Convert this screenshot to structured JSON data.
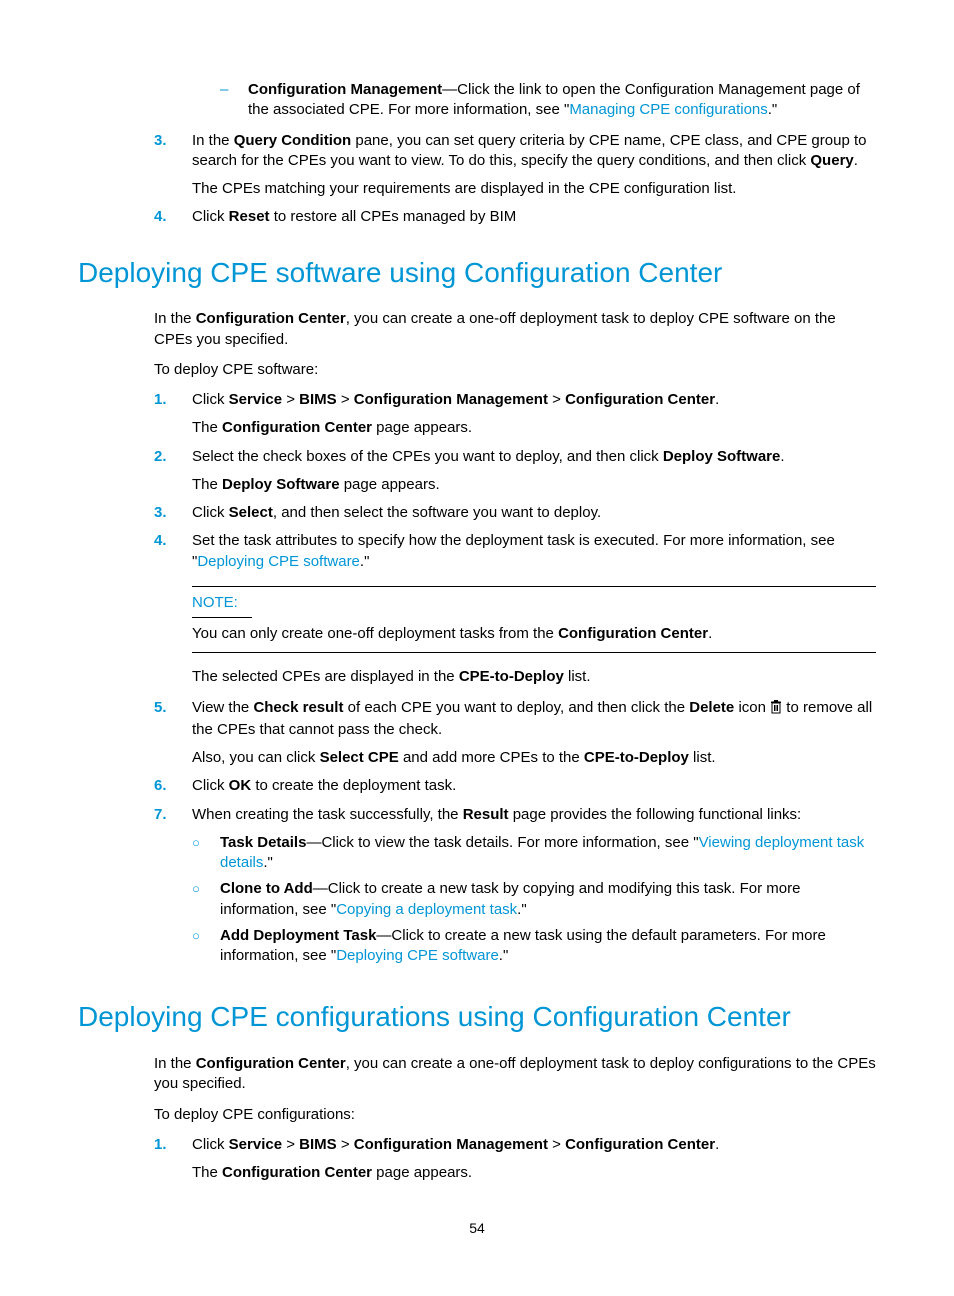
{
  "top_section": {
    "config_mgmt": {
      "label": "Configuration Management",
      "text1": "—Click the link to open the Configuration Management page of the associated CPE. For more information, see \"",
      "link": "Managing CPE configurations",
      "text2": ".\""
    },
    "step3": {
      "num": "3.",
      "line1a": "In the ",
      "bold1": "Query Condition",
      "line1b": " pane, you can set query criteria by CPE name, CPE class, and CPE group to search for the CPEs you want to view. To do this, specify the query conditions, and then click ",
      "bold2": "Query",
      "line1c": ".",
      "line2": "The CPEs matching your requirements are displayed in the CPE configuration list."
    },
    "step4": {
      "num": "4.",
      "a": "Click ",
      "bold": "Reset",
      "b": " to restore all CPEs managed by BIM"
    }
  },
  "sec1": {
    "heading": "Deploying CPE software using Configuration Center",
    "intro": {
      "a": "In the ",
      "bold": "Configuration Center",
      "b": ", you can create a one-off deployment task to deploy CPE software on the CPEs you specified."
    },
    "lead": "To deploy CPE software:",
    "s1": {
      "num": "1.",
      "a": "Click ",
      "b1": "Service",
      "gt1": " > ",
      "b2": "BIMS",
      "gt2": " > ",
      "b3": "Configuration Management",
      "gt3": " > ",
      "b4": "Configuration Center",
      "end": ".",
      "line2a": "The ",
      "line2b": "Configuration Center",
      "line2c": " page appears."
    },
    "s2": {
      "num": "2.",
      "a": "Select the check boxes of the CPEs you want to deploy, and then click ",
      "bold": "Deploy Software",
      "b": ".",
      "line2a": "The ",
      "line2b": "Deploy Software",
      "line2c": " page appears."
    },
    "s3": {
      "num": "3.",
      "a": "Click ",
      "bold": "Select",
      "b": ", and then select the software you want to deploy."
    },
    "s4": {
      "num": "4.",
      "a": "Set the task attributes to specify how the deployment task is executed. For more information, see \"",
      "link": "Deploying CPE software",
      "b": ".\""
    },
    "note": {
      "label": "NOTE:",
      "a": "You can only create one-off deployment tasks from the ",
      "bold": "Configuration Center",
      "b": "."
    },
    "after_note": {
      "a": "The selected CPEs are displayed in the ",
      "bold": "CPE-to-Deploy",
      "b": " list."
    },
    "s5": {
      "num": "5.",
      "a": "View the ",
      "b1": "Check result",
      "b": " of each CPE you want to deploy, and then click the ",
      "b2": "Delete",
      "c": " icon ",
      "d": " to remove all the CPEs that cannot pass the check.",
      "line2a": "Also, you can click ",
      "line2b": "Select CPE",
      "line2c": " and add more CPEs to the ",
      "line2d": "CPE-to-Deploy",
      "line2e": " list."
    },
    "s6": {
      "num": "6.",
      "a": "Click ",
      "bold": "OK",
      "b": " to create the deployment task."
    },
    "s7": {
      "num": "7.",
      "a": "When creating the task successfully, the ",
      "bold": "Result",
      "b": " page provides the following functional links:",
      "sub1": {
        "label": "Task Details",
        "a": "—Click to view the task details. For more information, see \"",
        "link": "Viewing deployment task details",
        "b": ".\""
      },
      "sub2": {
        "label": "Clone to Add",
        "a": "—Click to create a new task by copying and modifying this task. For more information, see \"",
        "link": "Copying a deployment task",
        "b": ".\""
      },
      "sub3": {
        "label": "Add Deployment Task",
        "a": "—Click to create a new task using the default parameters. For more information, see \"",
        "link": "Deploying CPE software",
        "b": ".\""
      }
    }
  },
  "sec2": {
    "heading": "Deploying CPE configurations using Configuration Center",
    "intro": {
      "a": "In the ",
      "bold": "Configuration Center",
      "b": ", you can create a one-off deployment task to deploy configurations to the CPEs you specified."
    },
    "lead": "To deploy CPE configurations:",
    "s1": {
      "num": "1.",
      "a": "Click ",
      "b1": "Service",
      "gt1": " > ",
      "b2": "BIMS",
      "gt2": " > ",
      "b3": "Configuration Management",
      "gt3": " > ",
      "b4": "Configuration Center",
      "end": ".",
      "line2a": "The ",
      "line2b": "Configuration Center",
      "line2c": " page appears."
    }
  },
  "pagenum": "54"
}
